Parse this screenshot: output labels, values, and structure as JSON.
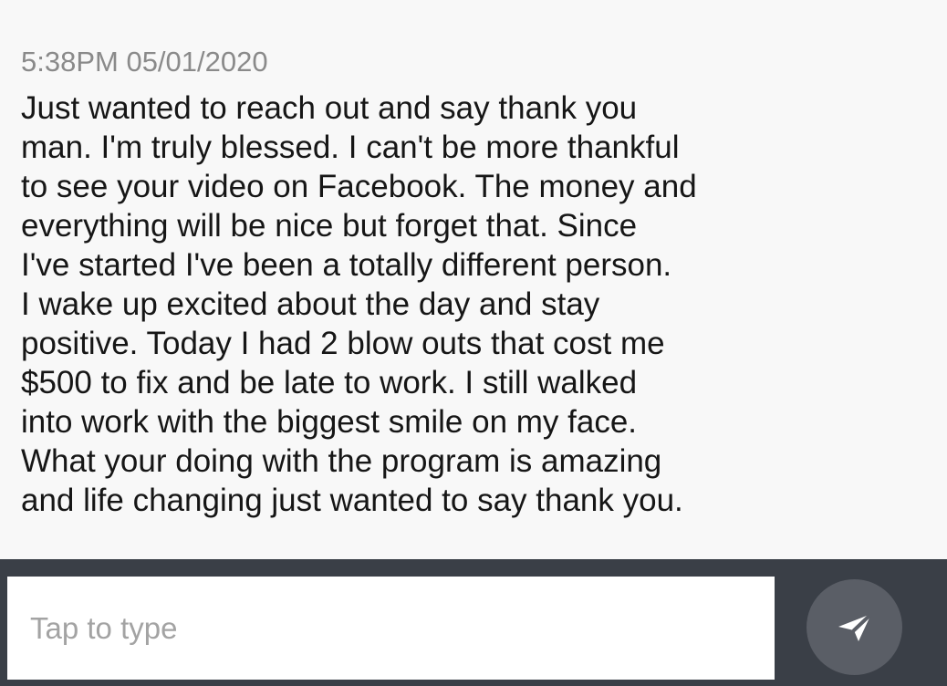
{
  "conversation": {
    "timestamp": "5:38PM 05/01/2020",
    "message_lines": [
      "Just wanted to reach out and say thank you",
      "man. I'm truly blessed. I can't be more thankful",
      "to see your video on Facebook. The money and",
      "everything will be nice but forget that. Since",
      "I've started I've been a totally different person.",
      "I wake up excited about the day and stay",
      "positive. Today I had 2 blow outs that cost me",
      "$500 to fix and be late to work. I still walked",
      "into work with the biggest smile on my face.",
      "What your doing with the program is amazing",
      "and life changing just wanted to say thank you."
    ]
  },
  "composer": {
    "value": "",
    "placeholder": "Tap to type",
    "send_icon": "send-icon"
  },
  "colors": {
    "message_background": "#f8f8f8",
    "composer_bar": "#3a3f47",
    "send_button": "#5a5e66",
    "timestamp_text": "#8a8a8a",
    "message_text": "#161616"
  }
}
